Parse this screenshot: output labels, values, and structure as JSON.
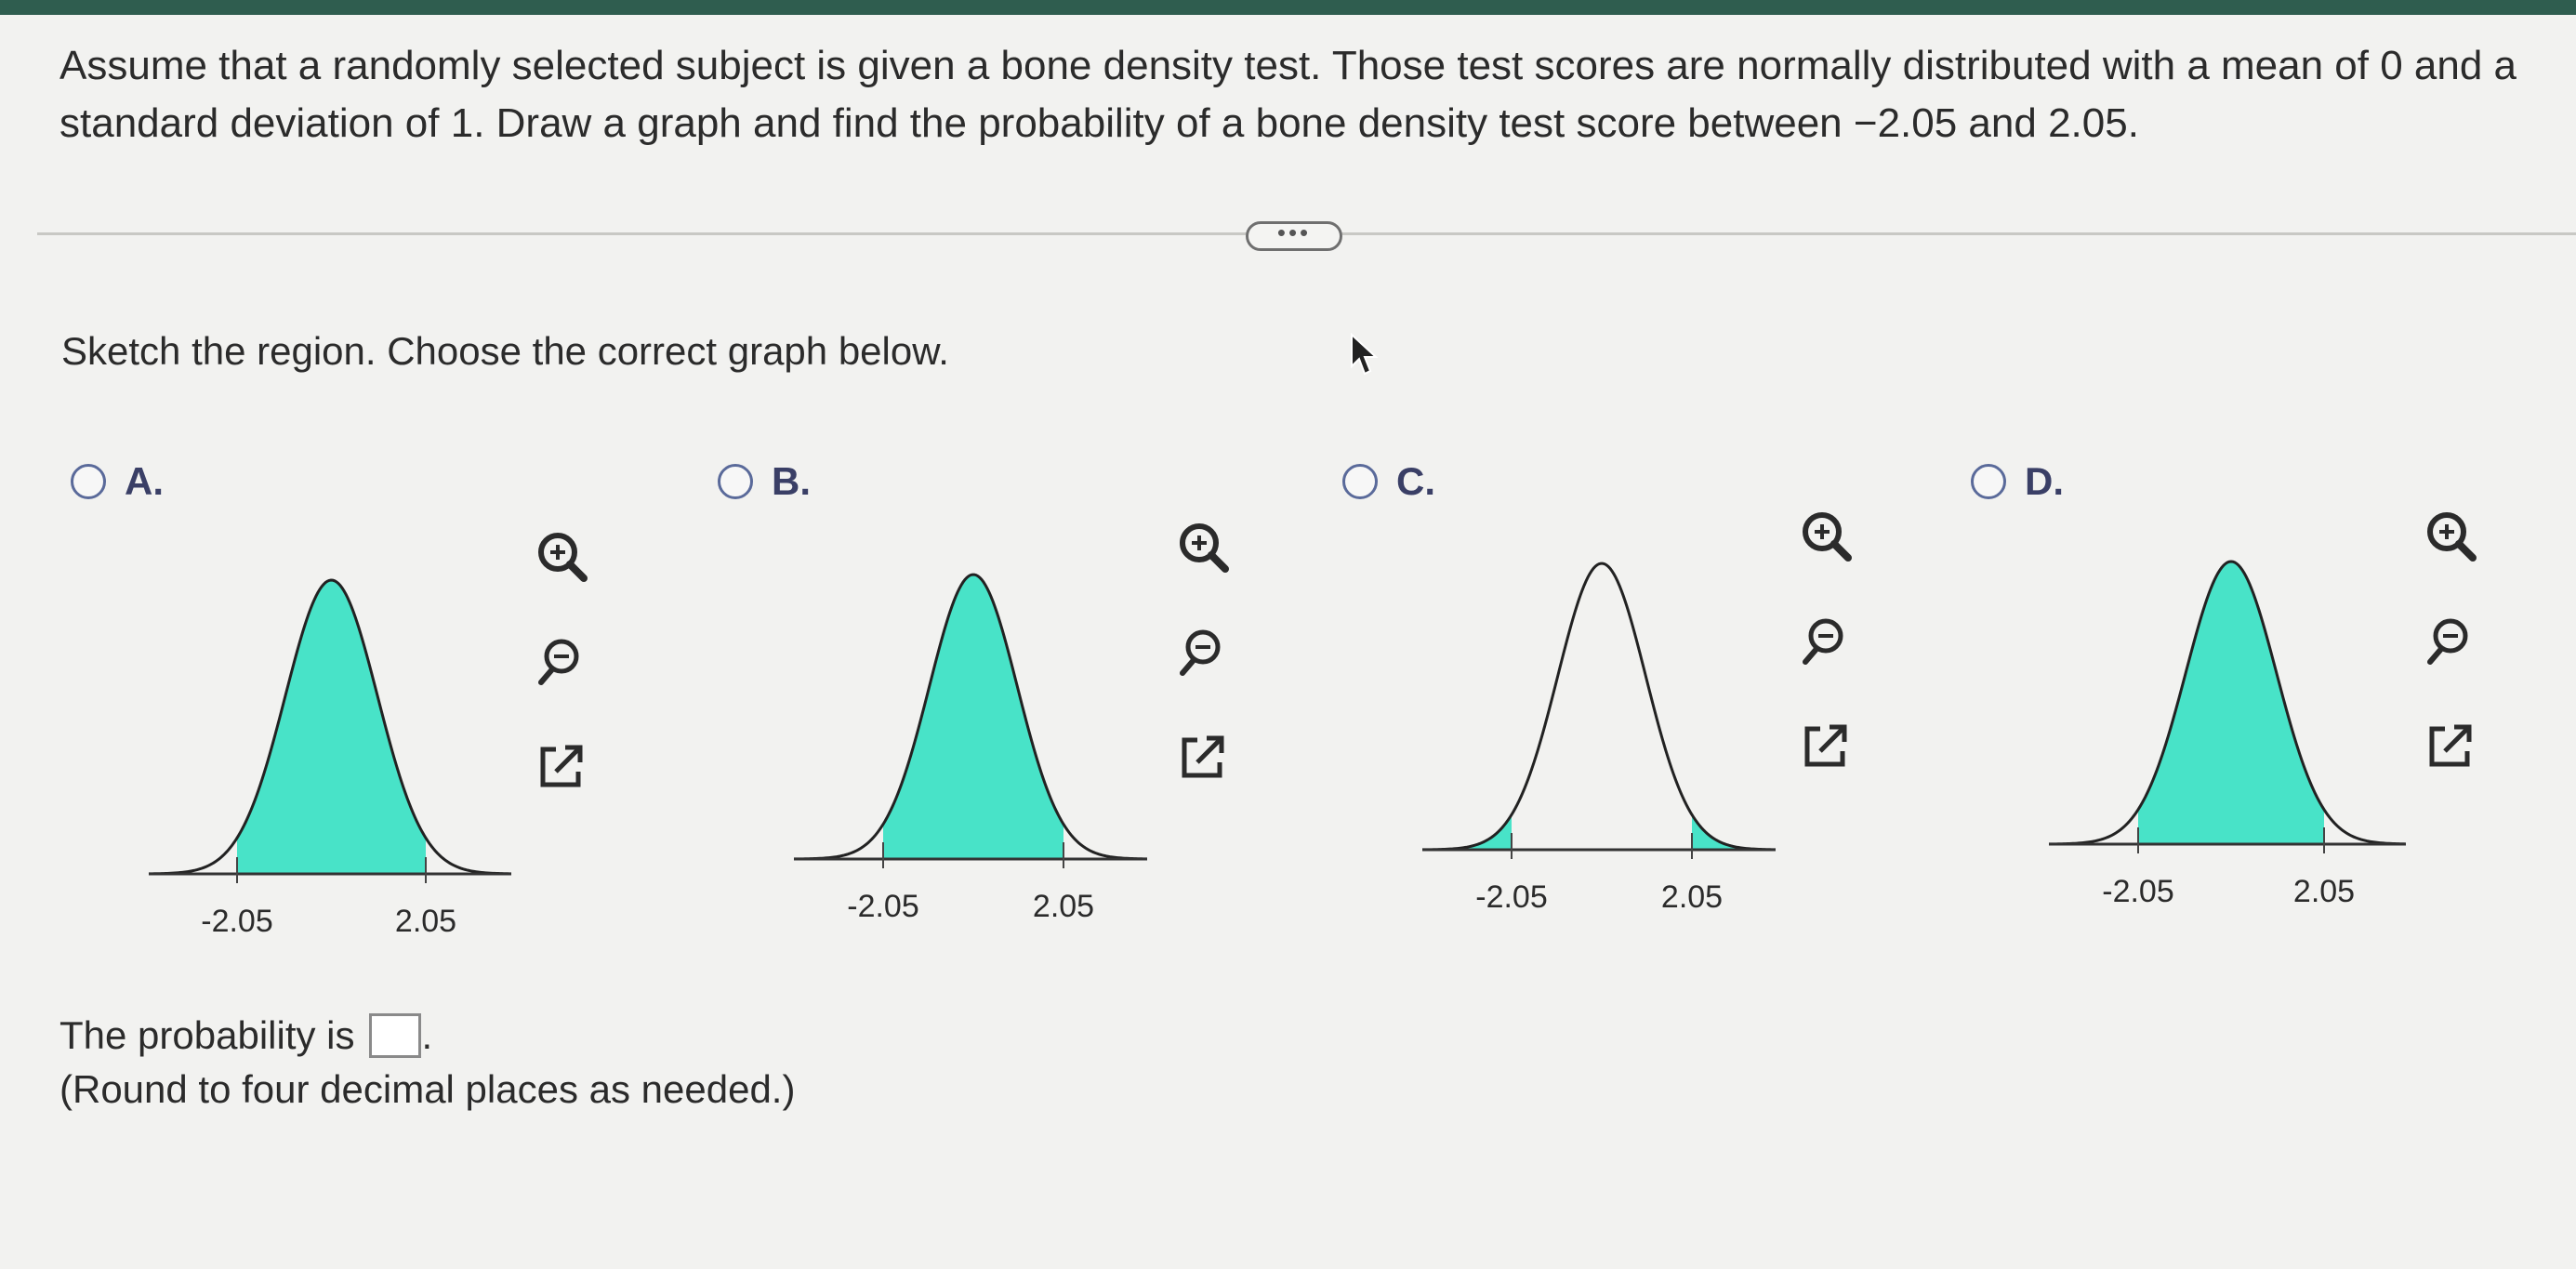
{
  "question": "Assume that a randomly selected subject is given a bone density test. Those test scores are normally distributed with a mean of 0 and a standard deviation of 1. Draw a graph and find the probability of a bone density test score between −2.05 and 2.05.",
  "more_button": "•••",
  "prompt": "Sketch the region. Choose the correct graph below.",
  "options": [
    {
      "letter": "A.",
      "shading": "between",
      "ticks": [
        "-2.05",
        "2.05"
      ]
    },
    {
      "letter": "B.",
      "shading": "between",
      "ticks": [
        "-2.05",
        "2.05"
      ]
    },
    {
      "letter": "C.",
      "shading": "tails",
      "ticks": [
        "-2.05",
        "2.05"
      ]
    },
    {
      "letter": "D.",
      "shading": "between",
      "ticks": [
        "-2.05",
        "2.05"
      ]
    }
  ],
  "tools": [
    "zoom-in-icon",
    "zoom-out-icon",
    "open-new-window-icon"
  ],
  "answer": {
    "prefix": "The probability is",
    "value": "",
    "suffix": "."
  },
  "note": "(Round to four decimal places as needed.)",
  "colors": {
    "fill": "#48e3c8",
    "curve": "#222222",
    "radio": "#5a6a9a",
    "label": "#3a3f66"
  }
}
